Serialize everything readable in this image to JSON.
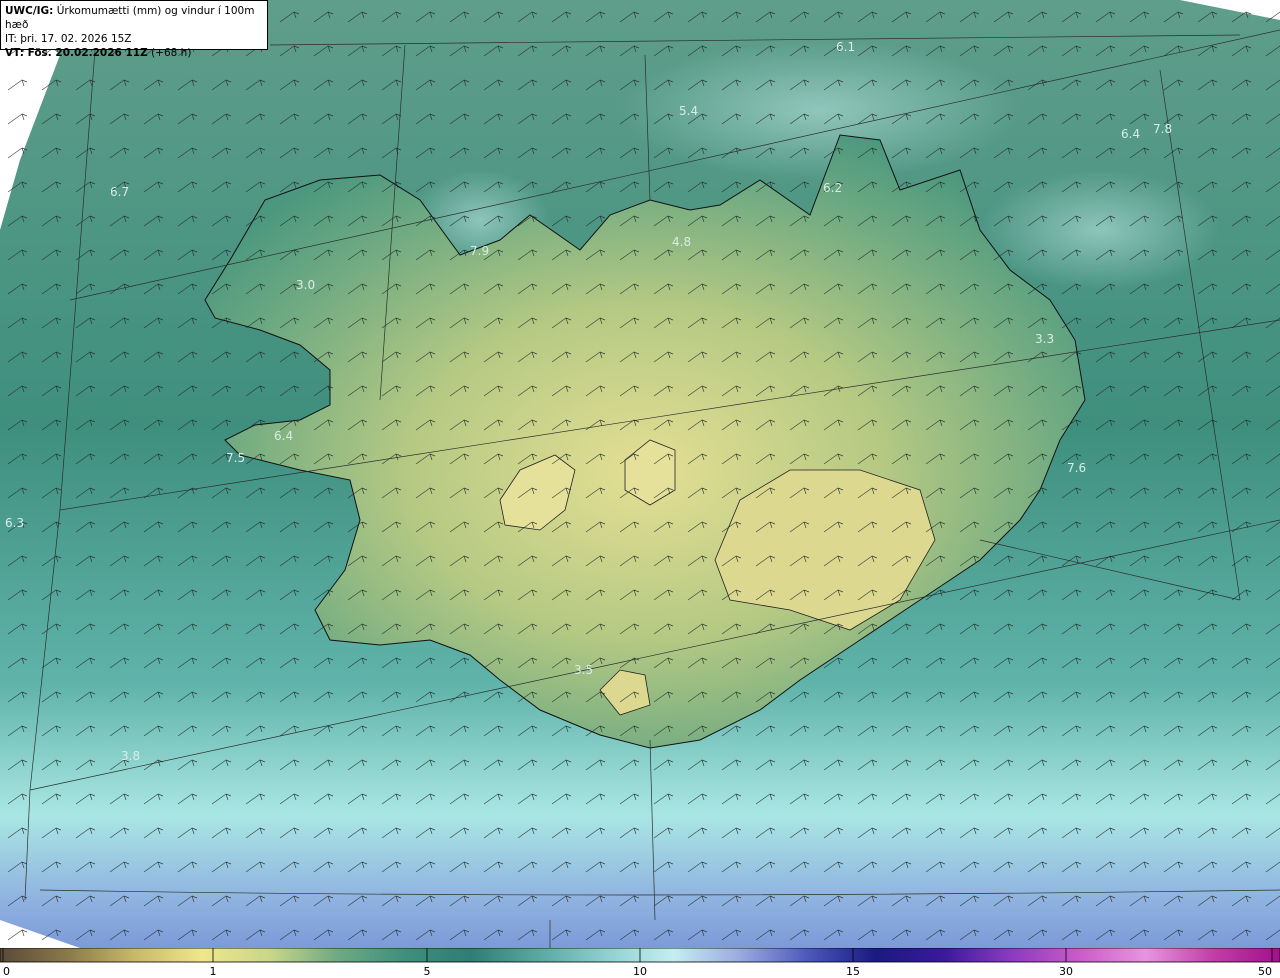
{
  "header": {
    "title_bold": "UWC/IG:",
    "title_rest": " Úrkomumætti (mm) og vindur í 100m hæð",
    "it_label": "IT:",
    "it_value": " þri. 17. 02. 2026 15Z",
    "vt_label": "VT: Fös. 20.02.2026 11Z",
    "vt_rest": " (+68 h)"
  },
  "map_values": [
    {
      "id": "v1",
      "text": "6.1"
    },
    {
      "id": "v2",
      "text": "5.4"
    },
    {
      "id": "v3",
      "text": "6.4"
    },
    {
      "id": "v4",
      "text": "7.8"
    },
    {
      "id": "v5",
      "text": "6.7"
    },
    {
      "id": "v6",
      "text": "6.2"
    },
    {
      "id": "v7",
      "text": "7.9"
    },
    {
      "id": "v8",
      "text": "4.8"
    },
    {
      "id": "v9",
      "text": "3.0"
    },
    {
      "id": "v10",
      "text": "3.3"
    },
    {
      "id": "v11",
      "text": "6.4"
    },
    {
      "id": "v12",
      "text": "7.5"
    },
    {
      "id": "v13",
      "text": "6.3"
    },
    {
      "id": "v14",
      "text": "7.6"
    },
    {
      "id": "v15",
      "text": "3.5"
    },
    {
      "id": "v16",
      "text": "3.8"
    }
  ],
  "scale": {
    "ticks": [
      {
        "label": "0",
        "value": 0
      },
      {
        "label": "1",
        "value": 1
      },
      {
        "label": "5",
        "value": 5
      },
      {
        "label": "10",
        "value": 10
      },
      {
        "label": "15",
        "value": 15
      },
      {
        "label": "30",
        "value": 30
      },
      {
        "label": "50",
        "value": 50
      }
    ],
    "colors": [
      "#5a4a3a",
      "#8a7a4a",
      "#c8b86a",
      "#f0e68c",
      "#c9d68a",
      "#6faa82",
      "#3f8f7e",
      "#2f7d74",
      "#5aa8a0",
      "#8fd0cf",
      "#c4eef0",
      "#9aa8e0",
      "#4a58b8",
      "#1a1a80",
      "#3a1a9a",
      "#8a3abf",
      "#c85ac8",
      "#e894e0",
      "#c040a8",
      "#a0108c"
    ]
  },
  "colors": {
    "sea_base": "#3f8f7e",
    "land_low": "#d8d98a",
    "land_mid": "#9ec07e",
    "sea_south_light": "#a9e6e4",
    "sea_far_south": "#7c9ad8"
  }
}
